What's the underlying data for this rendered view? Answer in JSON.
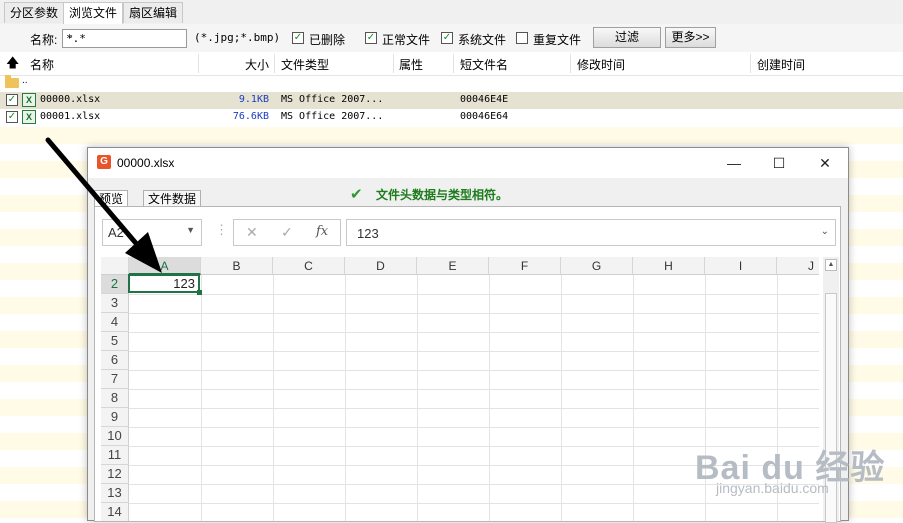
{
  "tabs": [
    {
      "label": "分区参数",
      "active": false
    },
    {
      "label": "浏览文件",
      "active": true
    },
    {
      "label": "扇区编辑",
      "active": false
    }
  ],
  "filter": {
    "name_label": "名称:",
    "name_value": "*.*",
    "type_hint": "(*.jpg;*.bmp)",
    "checkboxes": [
      {
        "label": "已删除",
        "checked": true
      },
      {
        "label": "正常文件",
        "checked": true
      },
      {
        "label": "系统文件",
        "checked": true
      },
      {
        "label": "重复文件",
        "checked": false
      }
    ],
    "filter_button": "过滤",
    "more_button": "更多>>"
  },
  "columns": [
    "名称",
    "大小",
    "文件类型",
    "属性",
    "短文件名",
    "修改时间",
    "创建时间"
  ],
  "parent_row": "..",
  "files": [
    {
      "name": "00000.xlsx",
      "size": "9.1KB",
      "type": "MS Office 2007...",
      "short_name": "00046E4E",
      "checked": true
    },
    {
      "name": "00001.xlsx",
      "size": "76.6KB",
      "type": "MS Office 2007...",
      "short_name": "00046E64",
      "checked": true
    }
  ],
  "dialog": {
    "title": "00000.xlsx",
    "tabs": [
      "预览",
      "文件数据"
    ],
    "status": "文件头数据与类型相符。",
    "name_box": "A2",
    "formula_value": "123",
    "col_headers": [
      "A",
      "B",
      "C",
      "D",
      "E",
      "F",
      "G",
      "H",
      "I",
      "J"
    ],
    "row_headers": [
      "2",
      "3",
      "4",
      "5",
      "6",
      "7",
      "8",
      "9",
      "10",
      "11",
      "12",
      "13",
      "14"
    ],
    "cell_a2": "123"
  },
  "watermark": {
    "line1": "Bai du 经验",
    "line2": "jingyan.baidu.com"
  }
}
